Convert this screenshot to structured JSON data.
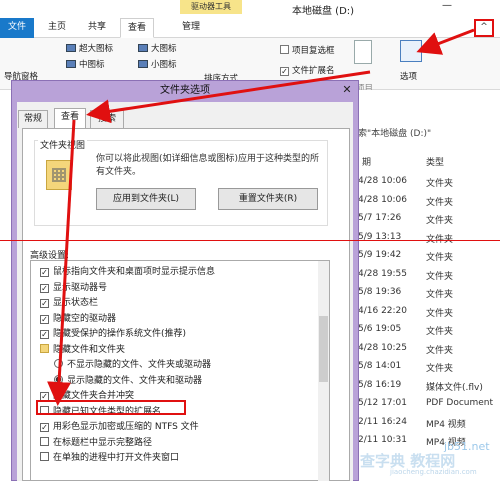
{
  "explorer": {
    "context_tab": "驱动器工具",
    "window_title": "本地磁盘 (D:)",
    "min_glyph": "—",
    "collapse_glyph": "^",
    "tabs": {
      "file": "文件",
      "home": "主页",
      "share": "共享",
      "view": "查看",
      "manage": "管理"
    },
    "ribbon": {
      "xl_icons": "超大图标",
      "large_icons": "大图标",
      "medium_icons": "中图标",
      "small_icons": "小图标",
      "nav_pane": "导航窗格",
      "sort_by": "排序方式",
      "item_checkbox": "项目复选框",
      "file_ext": "文件扩展名",
      "hidden_items": "隐藏\n所选项目",
      "hide_selected": "项目",
      "options": "选项"
    },
    "search_placeholder": "索\"本地磁盘 (D:)\"",
    "columns": {
      "date": "期",
      "type": "类型"
    },
    "rows": [
      {
        "date": "4/28 10:06",
        "type": "文件夹"
      },
      {
        "date": "4/28 10:06",
        "type": "文件夹"
      },
      {
        "date": "5/7 17:26",
        "type": "文件夹"
      },
      {
        "date": "5/9 13:13",
        "type": "文件夹"
      },
      {
        "date": "5/9 19:42",
        "type": "文件夹"
      },
      {
        "date": "4/28 19:55",
        "type": "文件夹"
      },
      {
        "date": "5/8 19:36",
        "type": "文件夹"
      },
      {
        "date": "4/16 22:20",
        "type": "文件夹"
      },
      {
        "date": "5/6 19:05",
        "type": "文件夹"
      },
      {
        "date": "4/28 10:25",
        "type": "文件夹"
      },
      {
        "date": "5/8 14:01",
        "type": "文件夹"
      },
      {
        "date": "5/8 16:19",
        "type": "媒体文件(.flv)"
      },
      {
        "date": "5/12 17:01",
        "type": "PDF Document"
      },
      {
        "date": "2/11 16:24",
        "type": "MP4 视频"
      },
      {
        "date": "2/11 10:31",
        "type": "MP4 视频"
      }
    ]
  },
  "dialog": {
    "title": "文件夹选项",
    "close_glyph": "✕",
    "tabs": {
      "general": "常规",
      "view": "查看",
      "search": "搜索"
    },
    "folder_view": {
      "title": "文件夹视图",
      "desc": "你可以将此视图(如详细信息或图标)应用于这种类型的所有文件夹。",
      "apply_btn": "应用到文件夹(L)",
      "reset_btn": "重置文件夹(R)"
    },
    "advanced_title": "高级设置:",
    "advanced_items": [
      {
        "label": "鼠标指向文件夹和桌面项时显示提示信息",
        "kind": "check",
        "checked": true
      },
      {
        "label": "显示驱动器号",
        "kind": "check",
        "checked": true
      },
      {
        "label": "显示状态栏",
        "kind": "check",
        "checked": true
      },
      {
        "label": "隐藏空的驱动器",
        "kind": "check",
        "checked": true
      },
      {
        "label": "隐藏受保护的操作系统文件(推荐)",
        "kind": "check",
        "checked": true
      },
      {
        "label": "隐藏文件和文件夹",
        "kind": "folder",
        "checked": false
      },
      {
        "label": "不显示隐藏的文件、文件夹或驱动器",
        "kind": "radio",
        "checked": false
      },
      {
        "label": "显示隐藏的文件、文件夹和驱动器",
        "kind": "radio",
        "checked": true
      },
      {
        "label": "隐藏文件夹合并冲突",
        "kind": "check",
        "checked": true
      },
      {
        "label": "隐藏已知文件类型的扩展名",
        "kind": "check",
        "checked": false
      },
      {
        "label": "用彩色显示加密或压缩的 NTFS 文件",
        "kind": "check",
        "checked": true
      },
      {
        "label": "在标题栏中显示完整路径",
        "kind": "check",
        "checked": false
      },
      {
        "label": "在单独的进程中打开文件夹窗口",
        "kind": "check",
        "checked": false
      }
    ]
  },
  "watermark": {
    "site": "jb51.net",
    "name": "查字典 教程网",
    "url": "jiaocheng.chazidian.com"
  },
  "colors": {
    "accent": "#1979ca",
    "annotation": "#e01010",
    "dialog_frame": "#b9a2d8"
  }
}
